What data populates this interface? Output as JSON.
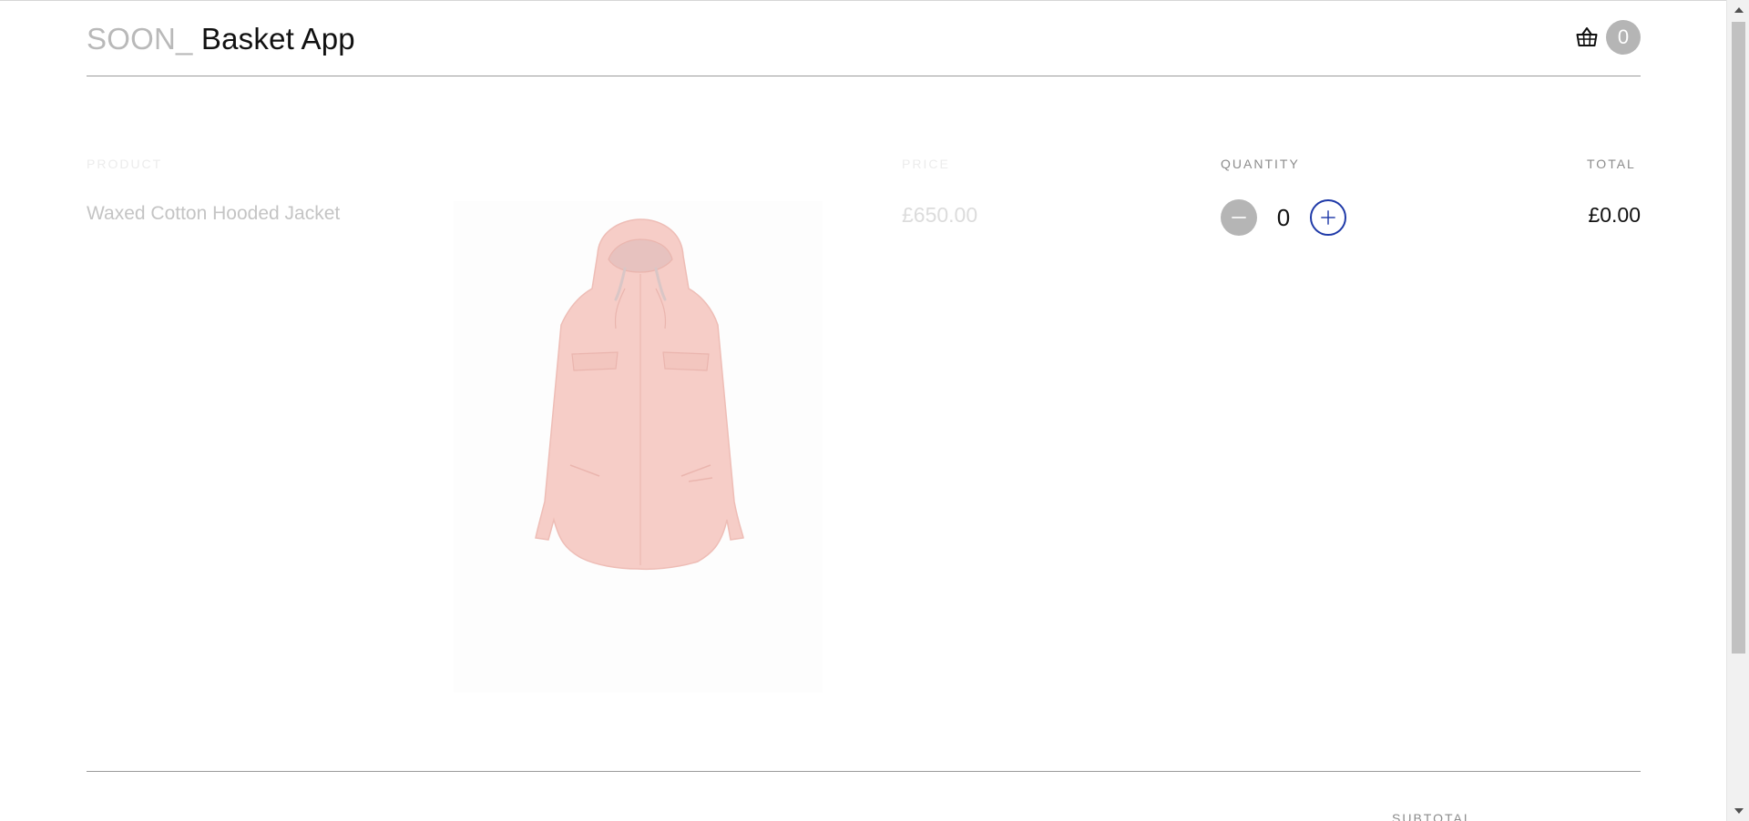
{
  "header": {
    "brand_prefix": "SOON_",
    "brand_name": " Basket App",
    "basket_count": "0"
  },
  "columns": {
    "product": "PRODUCT",
    "price": "PRICE",
    "quantity": "QUANTITY",
    "total": "TOTAL"
  },
  "item": {
    "name": "Waxed Cotton Hooded Jacket",
    "price": "£650.00",
    "quantity": "0",
    "total": "£0.00",
    "image_icon": "hooded-jacket-image",
    "image_color": "#f6cdc7"
  },
  "summary": {
    "subtotal_label": "SUBTOTAL"
  },
  "icons": {
    "basket": "basket-icon",
    "minus": "minus-icon",
    "plus": "plus-icon"
  },
  "colors": {
    "accent": "#1f3aa8",
    "badge": "#b5b5b5"
  }
}
